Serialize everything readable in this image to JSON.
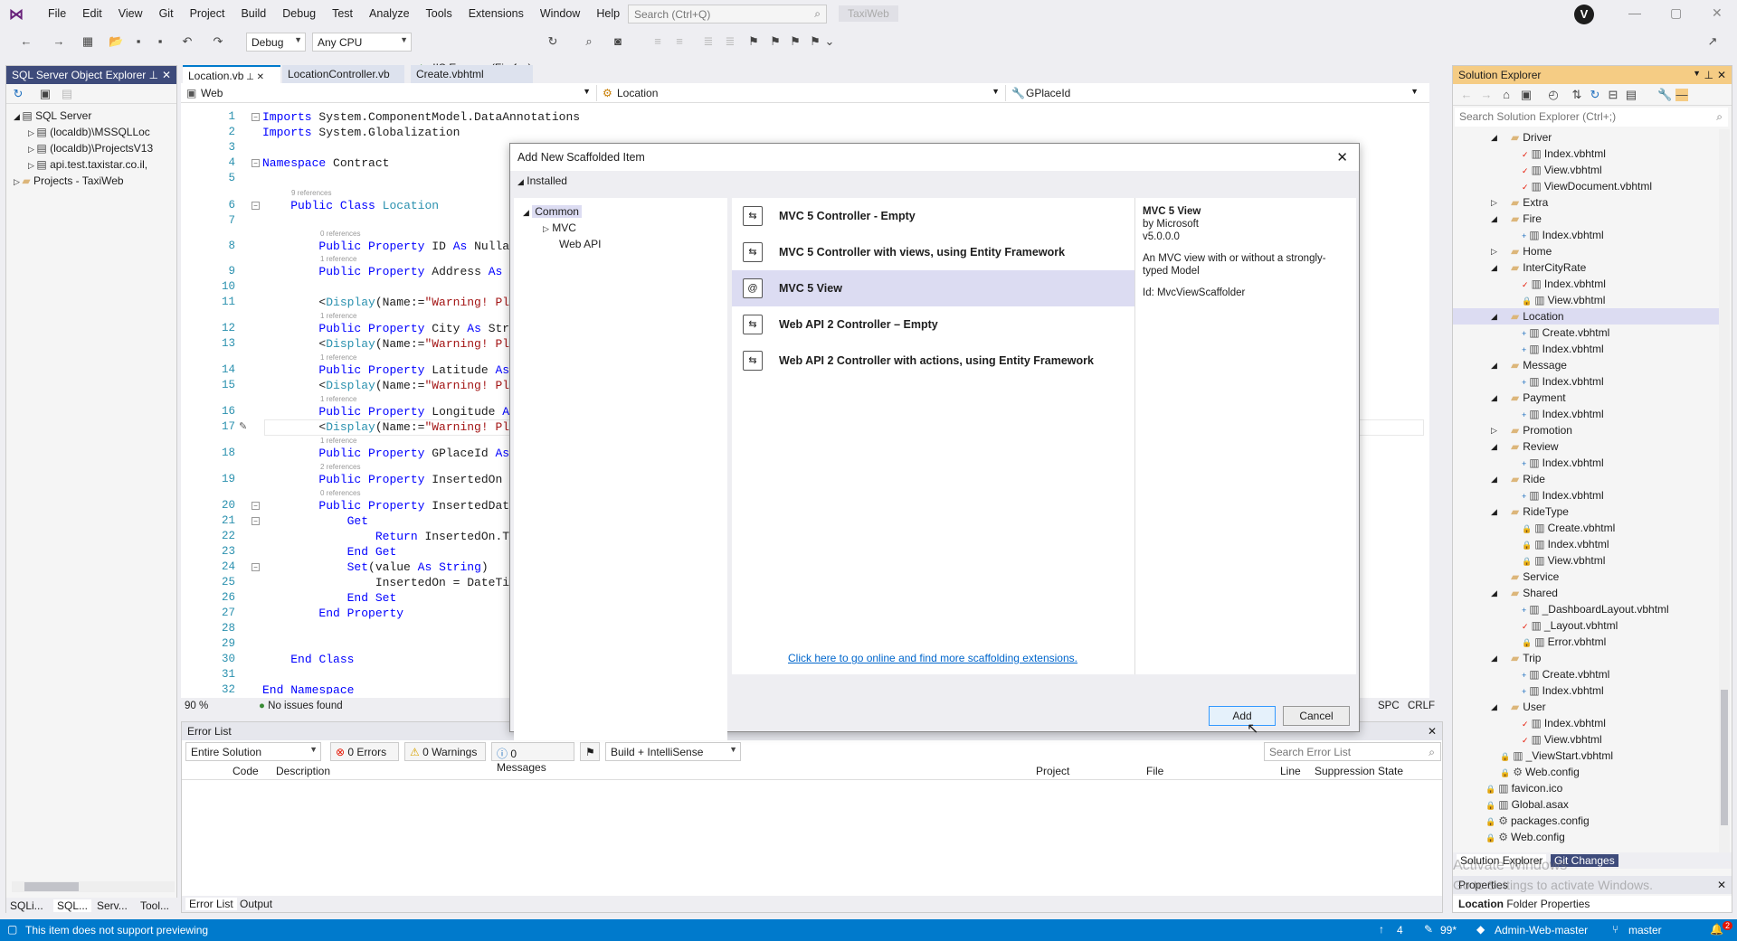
{
  "menubar": {
    "items": [
      "File",
      "Edit",
      "View",
      "Git",
      "Project",
      "Build",
      "Debug",
      "Test",
      "Analyze",
      "Tools",
      "Extensions",
      "Window",
      "Help"
    ],
    "search_placeholder": "Search (Ctrl+Q)",
    "app_title": "TaxiWeb",
    "avatar_letter": "V"
  },
  "toolbar": {
    "config": "Debug",
    "platform": "Any CPU",
    "run_label": "IIS Express (Firefox)"
  },
  "sql_explorer": {
    "title": "SQL Server Object Explorer",
    "items": [
      {
        "label": "SQL Server",
        "level": 0
      },
      {
        "label": "(localdb)\\MSSQLLoc",
        "level": 1
      },
      {
        "label": "(localdb)\\ProjectsV13",
        "level": 1
      },
      {
        "label": "api.test.taxistar.co.il,",
        "level": 1
      },
      {
        "label": "Projects - TaxiWeb",
        "level": 0
      }
    ],
    "bottom_tabs": [
      "SQLi...",
      "SQL...",
      "Serv...",
      "Tool..."
    ]
  },
  "editor": {
    "tabs": [
      "Location.vb",
      "LocationController.vb",
      "Create.vbhtml"
    ],
    "nav_project": "Web",
    "nav_class": "Location",
    "nav_member": "GPlaceId",
    "zoom": "90 %",
    "issues": "No issues found",
    "encoding": "SPC",
    "line_ending": "CRLF",
    "lines": [
      {
        "n": "1",
        "code": "Imports System.ComponentModel.DataAnnotations",
        "ref": ""
      },
      {
        "n": "2",
        "code": "Imports System.Globalization",
        "ref": ""
      },
      {
        "n": "3",
        "code": "",
        "ref": ""
      },
      {
        "n": "4",
        "code": "Namespace Contract",
        "ref": ""
      },
      {
        "n": "5",
        "code": "",
        "ref": ""
      },
      {
        "n": "6",
        "code": "    Public Class Location",
        "ref": "9 references"
      },
      {
        "n": "7",
        "code": "",
        "ref": ""
      },
      {
        "n": "8",
        "code": "        Public Property ID As Nullabl",
        "ref": "0 references"
      },
      {
        "n": "9",
        "code": "        Public Property Address As St",
        "ref": "1 reference"
      },
      {
        "n": "10",
        "code": "",
        "ref": ""
      },
      {
        "n": "11",
        "code": "        <Display(Name:=\"Warning! Plea",
        "ref": ""
      },
      {
        "n": "12",
        "code": "        Public Property City As Strin",
        "ref": "1 reference"
      },
      {
        "n": "13",
        "code": "        <Display(Name:=\"Warning! Plea",
        "ref": ""
      },
      {
        "n": "14",
        "code": "        Public Property Latitude As D",
        "ref": "1 reference"
      },
      {
        "n": "15",
        "code": "        <Display(Name:=\"Warning! Plea",
        "ref": ""
      },
      {
        "n": "16",
        "code": "        Public Property Longitude As ",
        "ref": "1 reference"
      },
      {
        "n": "17",
        "code": "        <Display(Name:=\"Warning! Plea",
        "ref": ""
      },
      {
        "n": "18",
        "code": "        Public Property GPlaceId As S",
        "ref": "1 reference"
      },
      {
        "n": "19",
        "code": "        Public Property InsertedOn As",
        "ref": "2 references"
      },
      {
        "n": "20",
        "code": "        Public Property InsertedDateS",
        "ref": "0 references"
      },
      {
        "n": "21",
        "code": "            Get",
        "ref": ""
      },
      {
        "n": "22",
        "code": "                Return InsertedOn.ToS",
        "ref": ""
      },
      {
        "n": "23",
        "code": "            End Get",
        "ref": ""
      },
      {
        "n": "24",
        "code": "            Set(value As String)",
        "ref": ""
      },
      {
        "n": "25",
        "code": "                InsertedOn = DateTime",
        "ref": ""
      },
      {
        "n": "26",
        "code": "            End Set",
        "ref": ""
      },
      {
        "n": "27",
        "code": "        End Property",
        "ref": ""
      },
      {
        "n": "28",
        "code": "",
        "ref": ""
      },
      {
        "n": "29",
        "code": "",
        "ref": ""
      },
      {
        "n": "30",
        "code": "    End Class",
        "ref": ""
      },
      {
        "n": "31",
        "code": "",
        "ref": ""
      },
      {
        "n": "32",
        "code": "End Namespace",
        "ref": ""
      }
    ]
  },
  "dialog": {
    "title": "Add New Scaffolded Item",
    "installed": "Installed",
    "tree": [
      "Common",
      "MVC",
      "Web API"
    ],
    "items": [
      {
        "label": "MVC 5 Controller - Empty",
        "icon": "controller-icon"
      },
      {
        "label": "MVC 5 Controller with views, using Entity Framework",
        "icon": "controller-ef-icon"
      },
      {
        "label": "MVC 5 View",
        "icon": "view-icon"
      },
      {
        "label": "Web API 2 Controller – Empty",
        "icon": "controller-icon"
      },
      {
        "label": "Web API 2 Controller with actions, using Entity Framework",
        "icon": "controller-icon"
      }
    ],
    "selected_index": 2,
    "detail": {
      "name": "MVC 5 View",
      "by": "by Microsoft",
      "version": "v5.0.0.0",
      "description": "An MVC view with or without a strongly-typed Model",
      "id": "Id: MvcViewScaffolder"
    },
    "online_link": "Click here to go online and find more scaffolding extensions.",
    "add_label": "Add",
    "cancel_label": "Cancel"
  },
  "error_list": {
    "title": "Error List",
    "scope": "Entire Solution",
    "errors": "0 Errors",
    "warnings": "0 Warnings",
    "messages": "0 Messages",
    "build_filter": "Build + IntelliSense",
    "search_placeholder": "Search Error List",
    "columns": [
      "Code",
      "Description",
      "Project",
      "File",
      "Line",
      "Suppression State"
    ],
    "bottom_tabs": [
      "Error List",
      "Output"
    ]
  },
  "solution_explorer": {
    "title": "Solution Explorer",
    "search_placeholder": "Search Solution Explorer (Ctrl+;)",
    "items": [
      {
        "label": "Driver",
        "type": "folder",
        "level": 0,
        "expander": "open"
      },
      {
        "label": "Index.vbhtml",
        "type": "file",
        "level": 1,
        "mark": "check"
      },
      {
        "label": "View.vbhtml",
        "type": "file",
        "level": 1,
        "mark": "check"
      },
      {
        "label": "ViewDocument.vbhtml",
        "type": "file",
        "level": 1,
        "mark": "check"
      },
      {
        "label": "Extra",
        "type": "folder",
        "level": 0,
        "expander": "closed"
      },
      {
        "label": "Fire",
        "type": "folder",
        "level": 0,
        "expander": "open"
      },
      {
        "label": "Index.vbhtml",
        "type": "file",
        "level": 1,
        "mark": "plus"
      },
      {
        "label": "Home",
        "type": "folder",
        "level": 0,
        "expander": "closed"
      },
      {
        "label": "InterCityRate",
        "type": "folder",
        "level": 0,
        "expander": "open"
      },
      {
        "label": "Index.vbhtml",
        "type": "file",
        "level": 1,
        "mark": "check"
      },
      {
        "label": "View.vbhtml",
        "type": "file",
        "level": 1,
        "mark": "lock"
      },
      {
        "label": "Location",
        "type": "folder",
        "level": 0,
        "expander": "open",
        "selected": true
      },
      {
        "label": "Create.vbhtml",
        "type": "file",
        "level": 1,
        "mark": "plus"
      },
      {
        "label": "Index.vbhtml",
        "type": "file",
        "level": 1,
        "mark": "plus"
      },
      {
        "label": "Message",
        "type": "folder",
        "level": 0,
        "expander": "open"
      },
      {
        "label": "Index.vbhtml",
        "type": "file",
        "level": 1,
        "mark": "plus"
      },
      {
        "label": "Payment",
        "type": "folder",
        "level": 0,
        "expander": "open"
      },
      {
        "label": "Index.vbhtml",
        "type": "file",
        "level": 1,
        "mark": "plus"
      },
      {
        "label": "Promotion",
        "type": "folder",
        "level": 0,
        "expander": "closed"
      },
      {
        "label": "Review",
        "type": "folder",
        "level": 0,
        "expander": "open"
      },
      {
        "label": "Index.vbhtml",
        "type": "file",
        "level": 1,
        "mark": "plus"
      },
      {
        "label": "Ride",
        "type": "folder",
        "level": 0,
        "expander": "open"
      },
      {
        "label": "Index.vbhtml",
        "type": "file",
        "level": 1,
        "mark": "plus"
      },
      {
        "label": "RideType",
        "type": "folder",
        "level": 0,
        "expander": "open"
      },
      {
        "label": "Create.vbhtml",
        "type": "file",
        "level": 1,
        "mark": "lock"
      },
      {
        "label": "Index.vbhtml",
        "type": "file",
        "level": 1,
        "mark": "lock"
      },
      {
        "label": "View.vbhtml",
        "type": "file",
        "level": 1,
        "mark": "lock"
      },
      {
        "label": "Service",
        "type": "folder",
        "level": 0,
        "expander": "none"
      },
      {
        "label": "Shared",
        "type": "folder",
        "level": 0,
        "expander": "open"
      },
      {
        "label": "_DashboardLayout.vbhtml",
        "type": "file",
        "level": 1,
        "mark": "plus"
      },
      {
        "label": "_Layout.vbhtml",
        "type": "file",
        "level": 1,
        "mark": "check"
      },
      {
        "label": "Error.vbhtml",
        "type": "file",
        "level": 1,
        "mark": "lock"
      },
      {
        "label": "Trip",
        "type": "folder",
        "level": 0,
        "expander": "open"
      },
      {
        "label": "Create.vbhtml",
        "type": "file",
        "level": 1,
        "mark": "plus"
      },
      {
        "label": "Index.vbhtml",
        "type": "file",
        "level": 1,
        "mark": "plus"
      },
      {
        "label": "User",
        "type": "folder",
        "level": 0,
        "expander": "open"
      },
      {
        "label": "Index.vbhtml",
        "type": "file",
        "level": 1,
        "mark": "check"
      },
      {
        "label": "View.vbhtml",
        "type": "file",
        "level": 1,
        "mark": "check"
      },
      {
        "label": "_ViewStart.vbhtml",
        "type": "file",
        "level": 0,
        "mark": "lock"
      },
      {
        "label": "Web.config",
        "type": "config",
        "level": 0,
        "mark": "lock"
      },
      {
        "label": "favicon.ico",
        "type": "file",
        "level": -1,
        "mark": "lock"
      },
      {
        "label": "Global.asax",
        "type": "file",
        "level": -1,
        "mark": "lock"
      },
      {
        "label": "packages.config",
        "type": "config",
        "level": -1,
        "mark": "lock"
      },
      {
        "label": "Web.config",
        "type": "config",
        "level": -1,
        "mark": "lock"
      }
    ],
    "bottom_tabs": [
      "Solution Explorer",
      "Git Changes"
    ],
    "watermark": "Activate Windows",
    "watermark2": "Go to Settings to activate Windows."
  },
  "properties": {
    "title": "Properties",
    "object": "Location",
    "object_type": "Folder Properties"
  },
  "statusbar": {
    "message": "This item does not support previewing",
    "up_count": "4",
    "edit_count": "99*",
    "repo": "Admin-Web-master",
    "branch": "master",
    "notif": "2"
  },
  "colors": {
    "accent": "#007acc",
    "selection": "#dcdcf2",
    "keyword": "#0000ff",
    "type": "#2b91af",
    "string": "#a31515"
  }
}
